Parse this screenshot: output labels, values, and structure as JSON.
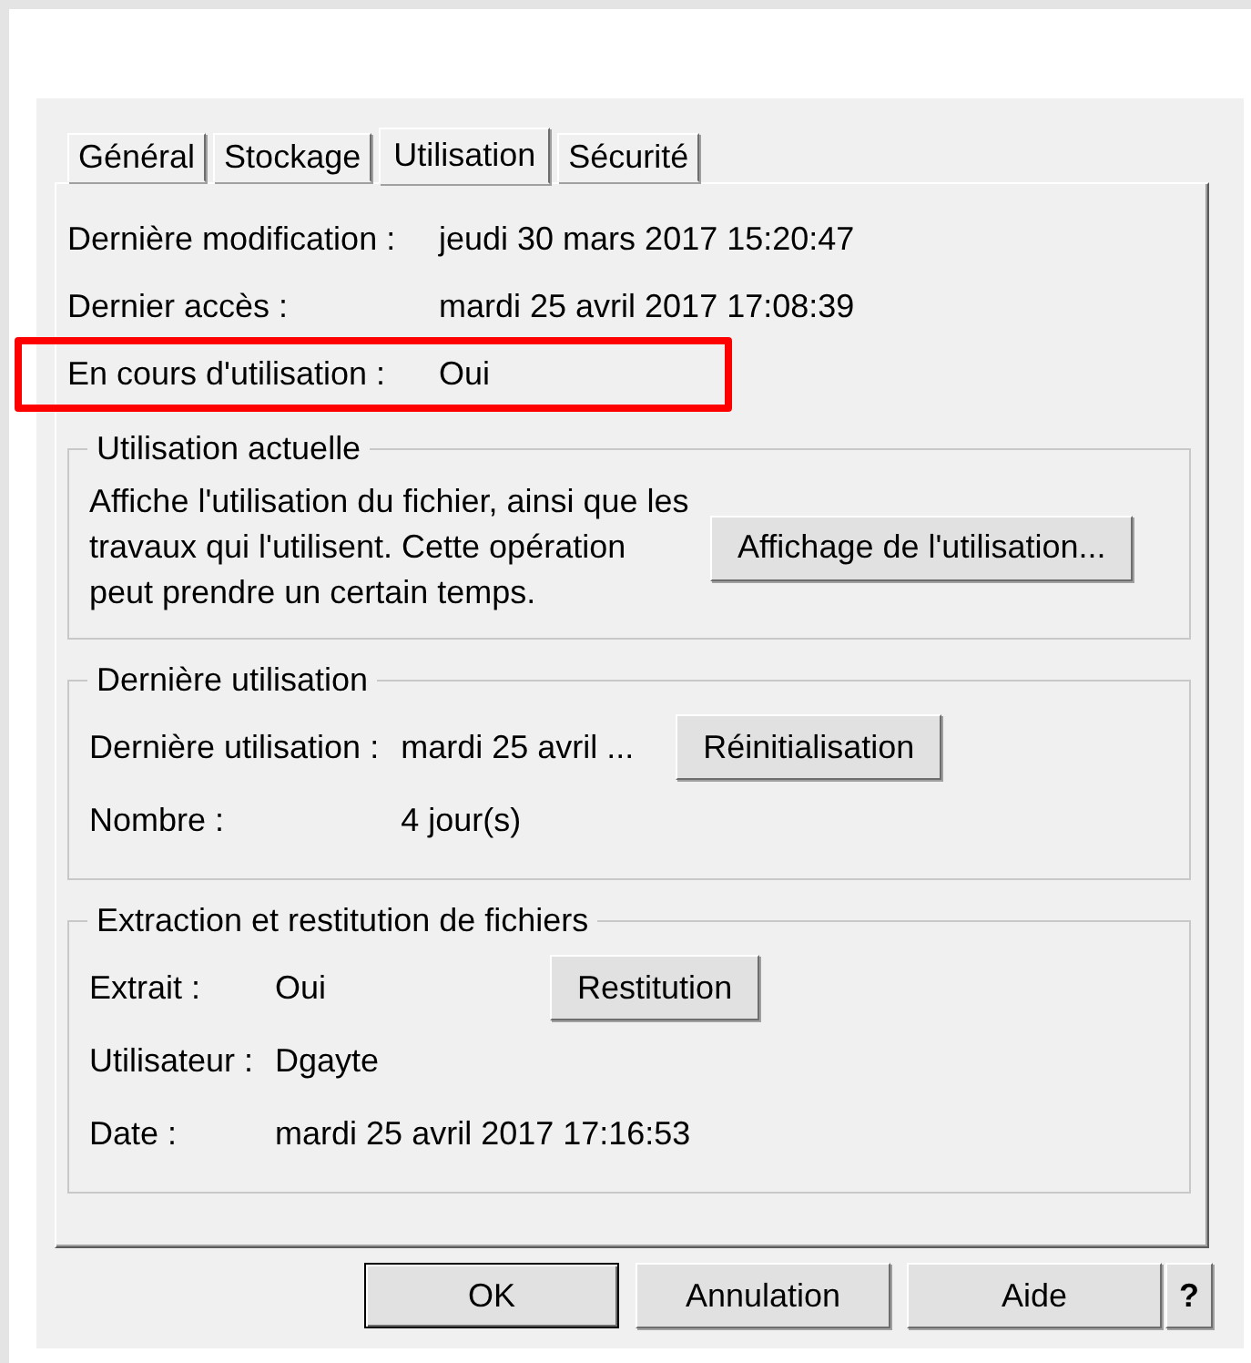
{
  "tabs": [
    {
      "label": "Général",
      "selected": false
    },
    {
      "label": "Stockage",
      "selected": false
    },
    {
      "label": "Utilisation",
      "selected": true
    },
    {
      "label": "Sécurité",
      "selected": false
    }
  ],
  "properties": [
    {
      "label": "Dernière modification :",
      "value": "jeudi 30 mars 2017 15:20:47",
      "highlighted": false
    },
    {
      "label": "Dernier accès :",
      "value": "mardi 25 avril 2017 17:08:39",
      "highlighted": false
    },
    {
      "label": "En cours d'utilisation :",
      "value": "Oui",
      "highlighted": true
    }
  ],
  "groups": [
    {
      "title": "Utilisation actuelle",
      "kind": "description",
      "text": "Affiche l'utilisation du fichier, ainsi que les travaux qui l'utilisent. Cette opération peut prendre un certain temps.",
      "button": "Affichage de l'utilisation..."
    },
    {
      "title": "Dernière utilisation",
      "kind": "fields",
      "fields": [
        {
          "label": "Dernière utilisation :",
          "value": "mardi 25 avril ..."
        },
        {
          "label": "Nombre :",
          "value": "4 jour(s)"
        }
      ],
      "button": "Réinitialisation"
    },
    {
      "title": "Extraction et restitution de fichiers",
      "kind": "fields",
      "fields": [
        {
          "label": "Extrait :",
          "value": "Oui"
        },
        {
          "label": "Utilisateur :",
          "value": "Dgayte"
        },
        {
          "label": "Date :",
          "value": "mardi 25 avril 2017 17:16:53"
        }
      ],
      "button": "Restitution"
    }
  ],
  "buttons": [
    {
      "label": "OK",
      "kind": "default"
    },
    {
      "label": "Annulation",
      "kind": "normal"
    },
    {
      "label": "Aide",
      "kind": "normal"
    },
    {
      "label": "?",
      "kind": "help"
    }
  ]
}
